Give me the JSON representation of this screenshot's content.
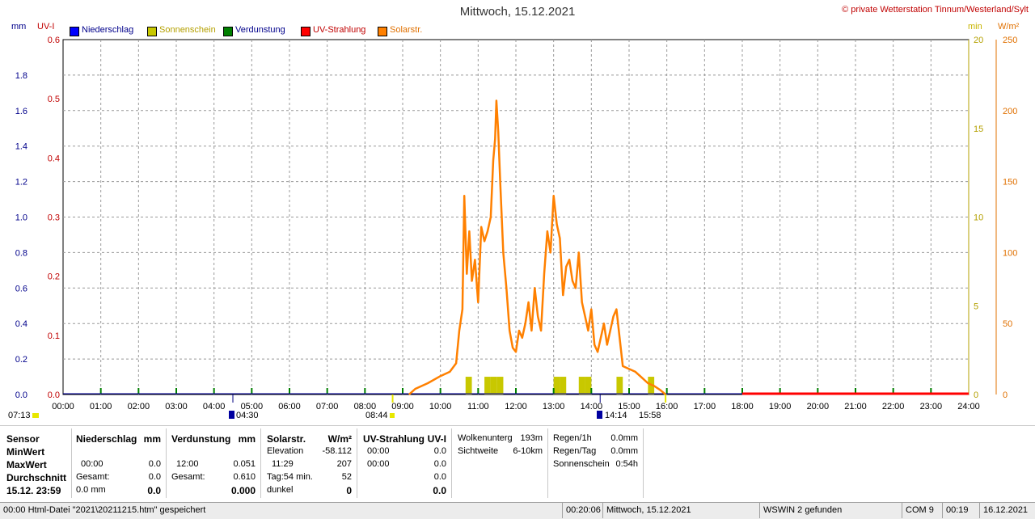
{
  "title": "Mittwoch, 15.12.2021",
  "copyright": "© private Wetterstation Tinnum/Westerland/Sylt",
  "axes": {
    "left1_unit": "mm",
    "left2_unit": "UV-I",
    "right1_unit": "min",
    "right2_unit": "W/m²",
    "mm_ticks": [
      "1.8",
      "1.6",
      "1.4",
      "1.2",
      "1.0",
      "0.8",
      "0.6",
      "0.4",
      "0.2",
      "0.0"
    ],
    "uv_ticks": [
      "0.6",
      "0.5",
      "0.4",
      "0.3",
      "0.2",
      "0.1",
      "0.0"
    ],
    "min_ticks": [
      "20",
      "15",
      "10",
      "5",
      "0"
    ],
    "wm2_ticks": [
      "250",
      "200",
      "150",
      "100",
      "50",
      "0"
    ],
    "x_ticks": [
      "00:00",
      "01:00",
      "02:00",
      "03:00",
      "04:00",
      "05:00",
      "06:00",
      "07:00",
      "08:00",
      "09:00",
      "10:00",
      "11:00",
      "12:00",
      "13:00",
      "14:00",
      "15:00",
      "16:00",
      "17:00",
      "18:00",
      "19:00",
      "20:00",
      "21:00",
      "22:00",
      "23:00",
      "24:00"
    ]
  },
  "legend": [
    {
      "label": "Niederschlag",
      "color": "#0000ff"
    },
    {
      "label": "Sonnenschein",
      "color": "#c8c800"
    },
    {
      "label": "Verdunstung",
      "color": "#008000"
    },
    {
      "label": "UV-Strahlung",
      "color": "#ff0000"
    },
    {
      "label": "Solarstr.",
      "color": "#ff8000"
    }
  ],
  "markers": {
    "m1": "07:13",
    "m2": "04:30",
    "m3": "08:44",
    "m4": "14:14",
    "m5": "15:58"
  },
  "chart_data": {
    "type": "line",
    "title": "Mittwoch, 15.12.2021",
    "x_range": [
      "00:00",
      "24:00"
    ],
    "ylim_mm": [
      0,
      2.0
    ],
    "ylim_uv": [
      0,
      0.6
    ],
    "ylim_min": [
      0,
      20
    ],
    "ylim_wm2": [
      0,
      250
    ],
    "grid": true,
    "solar_wm2": {
      "name": "Solarstr.",
      "points": [
        [
          "09:10",
          0
        ],
        [
          "09:20",
          4
        ],
        [
          "09:40",
          8
        ],
        [
          "10:00",
          13
        ],
        [
          "10:15",
          16
        ],
        [
          "10:25",
          22
        ],
        [
          "10:30",
          45
        ],
        [
          "10:35",
          60
        ],
        [
          "10:38",
          140
        ],
        [
          "10:42",
          85
        ],
        [
          "10:46",
          115
        ],
        [
          "10:50",
          80
        ],
        [
          "10:55",
          95
        ],
        [
          "11:00",
          65
        ],
        [
          "11:05",
          118
        ],
        [
          "11:10",
          108
        ],
        [
          "11:15",
          115
        ],
        [
          "11:20",
          125
        ],
        [
          "11:24",
          165
        ],
        [
          "11:27",
          180
        ],
        [
          "11:29",
          207
        ],
        [
          "11:32",
          185
        ],
        [
          "11:35",
          150
        ],
        [
          "11:40",
          100
        ],
        [
          "11:45",
          75
        ],
        [
          "11:50",
          45
        ],
        [
          "11:55",
          33
        ],
        [
          "12:00",
          30
        ],
        [
          "12:05",
          45
        ],
        [
          "12:10",
          40
        ],
        [
          "12:15",
          50
        ],
        [
          "12:20",
          65
        ],
        [
          "12:25",
          45
        ],
        [
          "12:30",
          75
        ],
        [
          "12:35",
          55
        ],
        [
          "12:40",
          45
        ],
        [
          "12:45",
          85
        ],
        [
          "12:50",
          115
        ],
        [
          "12:55",
          100
        ],
        [
          "13:00",
          140
        ],
        [
          "13:05",
          120
        ],
        [
          "13:10",
          110
        ],
        [
          "13:15",
          70
        ],
        [
          "13:20",
          90
        ],
        [
          "13:25",
          95
        ],
        [
          "13:30",
          80
        ],
        [
          "13:35",
          75
        ],
        [
          "13:40",
          100
        ],
        [
          "13:45",
          65
        ],
        [
          "13:50",
          55
        ],
        [
          "13:55",
          45
        ],
        [
          "14:00",
          60
        ],
        [
          "14:05",
          35
        ],
        [
          "14:10",
          30
        ],
        [
          "14:15",
          40
        ],
        [
          "14:20",
          50
        ],
        [
          "14:25",
          35
        ],
        [
          "14:30",
          45
        ],
        [
          "14:35",
          55
        ],
        [
          "14:40",
          60
        ],
        [
          "14:45",
          40
        ],
        [
          "14:50",
          20
        ],
        [
          "15:00",
          18
        ],
        [
          "15:10",
          16
        ],
        [
          "15:20",
          12
        ],
        [
          "15:30",
          8
        ],
        [
          "15:40",
          6
        ],
        [
          "15:50",
          3
        ],
        [
          "15:58",
          0
        ]
      ]
    },
    "sunshine_min": {
      "name": "Sonnenschein",
      "bars": [
        [
          "10:40",
          1.0
        ],
        [
          "11:10",
          1.0
        ],
        [
          "11:20",
          1.0
        ],
        [
          "11:30",
          1.0
        ],
        [
          "13:00",
          1.0
        ],
        [
          "13:10",
          1.0
        ],
        [
          "13:40",
          1.0
        ],
        [
          "13:50",
          1.0
        ],
        [
          "14:40",
          1.0
        ],
        [
          "15:30",
          1.0
        ]
      ]
    },
    "evaporation_mm": {
      "name": "Verdunstung",
      "total": 0.61
    },
    "precipitation_mm": {
      "name": "Niederschlag",
      "total": 0.0
    },
    "uv": {
      "name": "UV-Strahlung",
      "segment": [
        "18:00",
        "24:00"
      ],
      "value": 0.0
    }
  },
  "table": {
    "sensor": {
      "h": "Sensor",
      "r1": "MinWert",
      "r2": "MaxWert",
      "r3": "Durchschnitt",
      "r4": "15.12. 23:59"
    },
    "niederschlag": {
      "h": "Niederschlag",
      "u": "mm",
      "r2a": "00:00",
      "r2b": "0.0",
      "r3a": "Gesamt:",
      "r3b": "0.0",
      "r4a": "0.0 mm",
      "r4b": "0.0"
    },
    "verdunstung": {
      "h": "Verdunstung",
      "u": "mm",
      "r2a": "12:00",
      "r2b": "0.051",
      "r3a": "Gesamt:",
      "r3b": "0.610",
      "r4b": "0.000"
    },
    "solar": {
      "h": "Solarstr.",
      "u": "W/m²",
      "r1a": "Elevation",
      "r1b": "-58.112",
      "r2a": "11:29",
      "r2b": "207",
      "r3a": "Tag:54 min.",
      "r3b": "52",
      "r4a": "dunkel",
      "r4b": "0"
    },
    "uv": {
      "h": "UV-Strahlung",
      "u": "UV-I",
      "r1a": "00:00",
      "r1b": "0.0",
      "r2a": "00:00",
      "r2b": "0.0",
      "r3b": "0.0",
      "r4b": "0.0"
    },
    "cloud": {
      "r1a": "Wolkenunterg",
      "r1b": "193m",
      "r2a": "Sichtweite",
      "r2b": "6-10km"
    },
    "rain": {
      "r1a": "Regen/1h",
      "r1b": "0.0mm",
      "r2a": "Regen/Tag",
      "r2b": "0.0mm",
      "r3a": "Sonnenschein",
      "r3b": "0:54h"
    }
  },
  "status": {
    "s1": "00:00  Html-Datei  \"2021\\20211215.htm\"  gespeichert",
    "s2": "00:20:06",
    "s3": "Mittwoch, 15.12.2021",
    "s4": "WSWIN 2 gefunden",
    "s5": "COM 9",
    "s6": "00:19",
    "s7": "16.12.2021"
  }
}
